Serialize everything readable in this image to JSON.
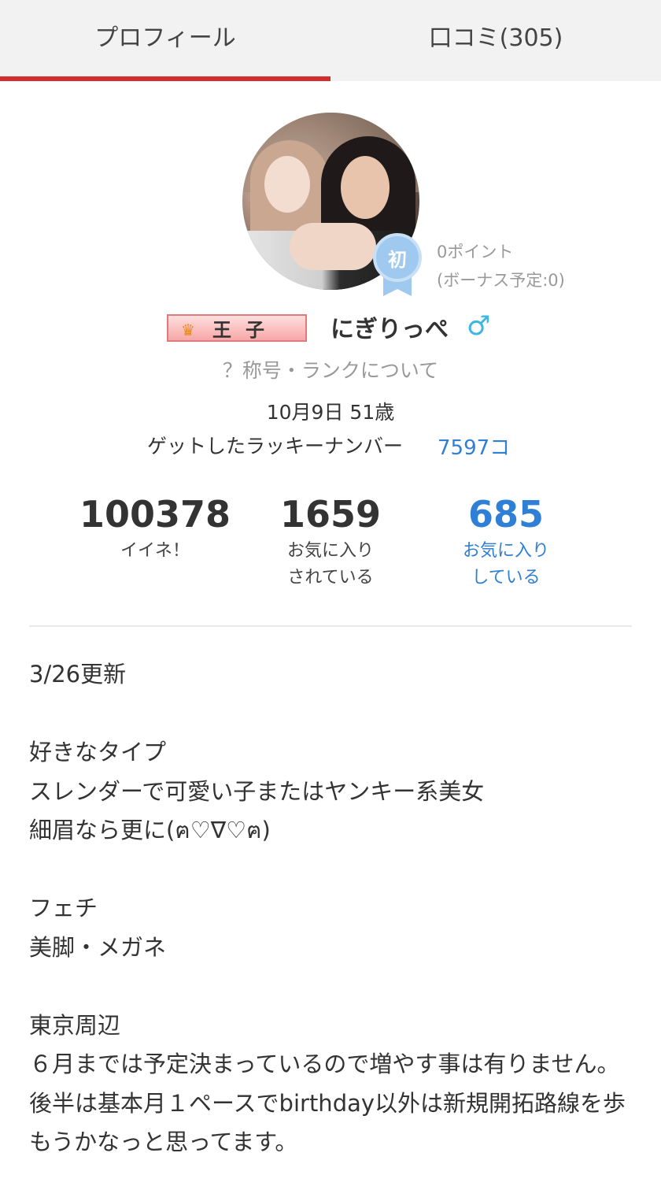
{
  "tabs": [
    {
      "label": "プロフィール",
      "active": true
    },
    {
      "label": "口コミ(305)",
      "active": false
    }
  ],
  "badge": {
    "label": "初",
    "color": "#9fc9ee"
  },
  "points": {
    "line1": "0ポイント",
    "line2": "(ボーナス予定:0)"
  },
  "title_badge": {
    "icon": "crown-icon",
    "label": "王子"
  },
  "username": "にぎりっぺ",
  "gender_symbol": "♂",
  "rank_link": "？称号・ランクについて",
  "birthday": "10月9日 51歳",
  "lucky": {
    "label": "ゲットしたラッキーナンバー",
    "value": "7597コ"
  },
  "stats": [
    {
      "value": "100378",
      "label1": "イイネ！",
      "label2": ""
    },
    {
      "value": "1659",
      "label1": "お気に入り",
      "label2": "されている"
    },
    {
      "value": "685",
      "label1": "お気に入り",
      "label2": "している"
    }
  ],
  "bio": "3/26更新\n\n好きなタイプ\nスレンダーで可愛い子またはヤンキー系美女\n細眉なら更に(ฅ♡∇♡ฅ)\n\nフェチ\n美脚・メガネ\n\n東京周辺\n６月までは予定決まっているので増やす事は有りません。\n後半は基本月１ペースでbirthday以外は新規開拓路線を歩もうかなっと思ってます。",
  "colors": {
    "accent_red": "#d42d2d",
    "link_blue": "#2f7fd6",
    "gender_blue": "#3cb6e3"
  }
}
